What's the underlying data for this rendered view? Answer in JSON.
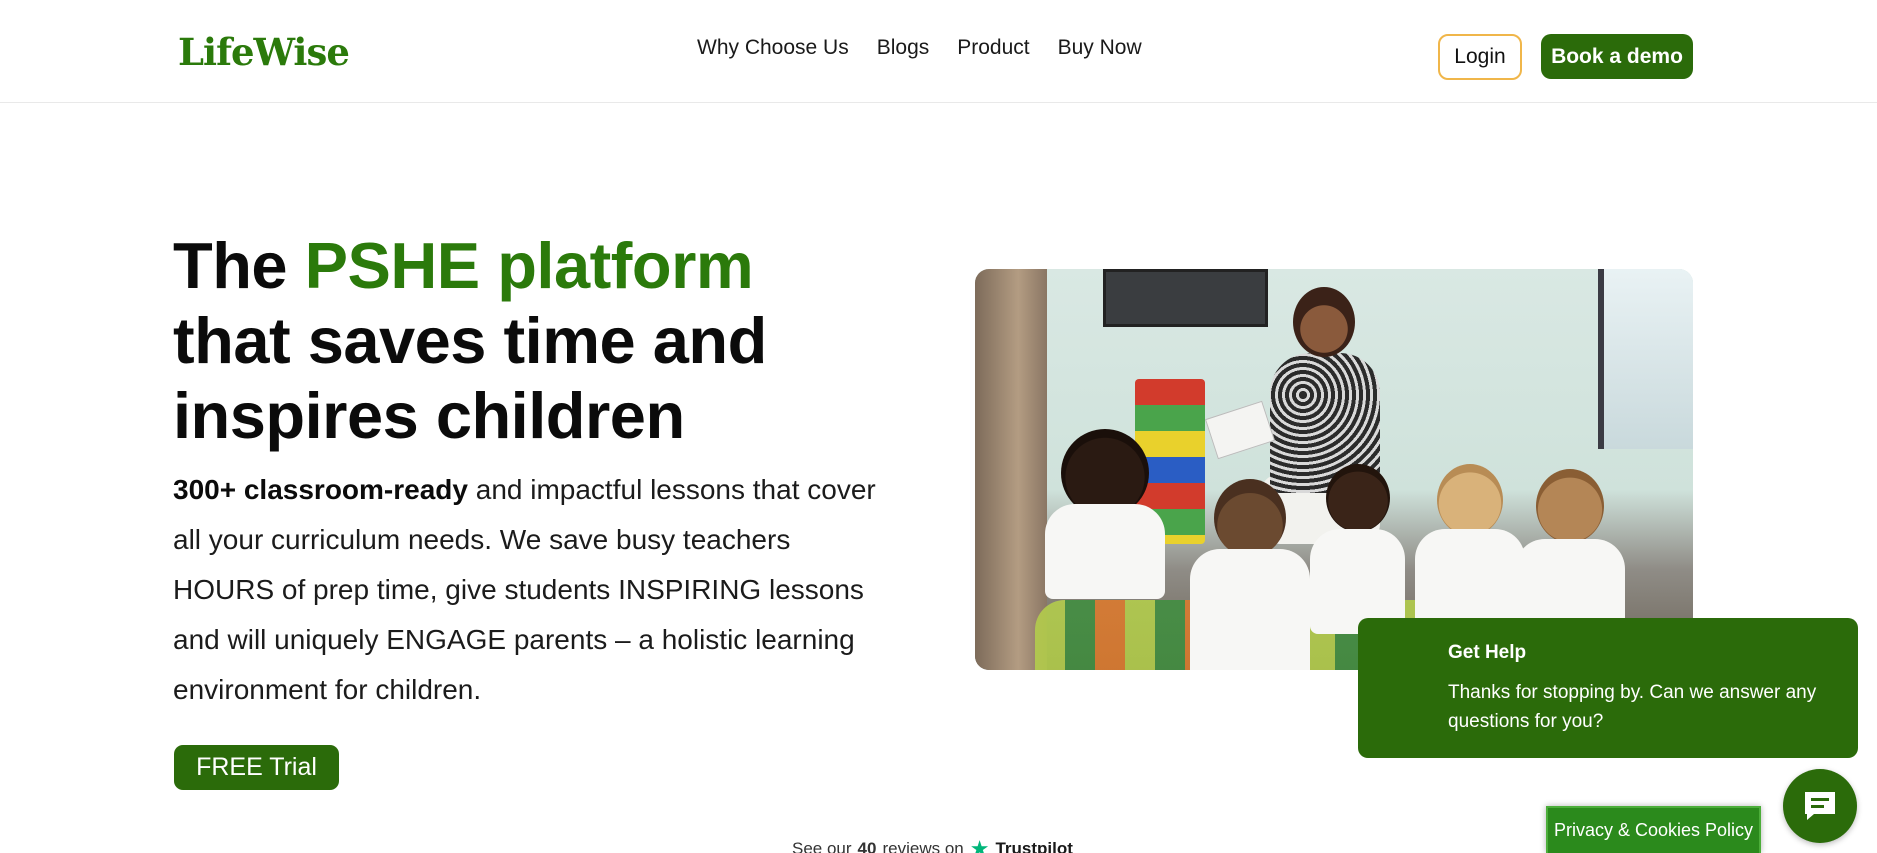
{
  "header": {
    "logo": "LifeWise",
    "nav": [
      "Why Choose Us",
      "Blogs",
      "Product",
      "Buy Now"
    ],
    "login_label": "Login",
    "demo_label": "Book a demo"
  },
  "hero": {
    "title_pre": "The ",
    "title_accent": "PSHE platform",
    "title_line2": "that saves time and",
    "title_line3": "inspires children",
    "text_bold": "300+ classroom-ready",
    "text_rest": " and impactful lessons that cover all your curriculum needs. We save busy teachers HOURS of prep time, give students INSPIRING lessons and will uniquely ENGAGE parents – a holistic learning environment for children.",
    "trial_label": "FREE Trial"
  },
  "trustpilot": {
    "prefix": "See our",
    "count": "40",
    "suffix": "reviews on",
    "brand": "Trustpilot"
  },
  "help_widget": {
    "title": "Get Help",
    "message": "Thanks for stopping by. Can we answer any questions for you?"
  },
  "privacy_label": "Privacy & Cookies Policy",
  "colors": {
    "brand_green": "#2b6b0a",
    "accent_green": "#2b7a0b",
    "login_border": "#f0b64a",
    "trustpilot_star": "#00b67a"
  },
  "icons": {
    "chat": "chat-bubble-icon",
    "trustpilot": "star-icon"
  }
}
